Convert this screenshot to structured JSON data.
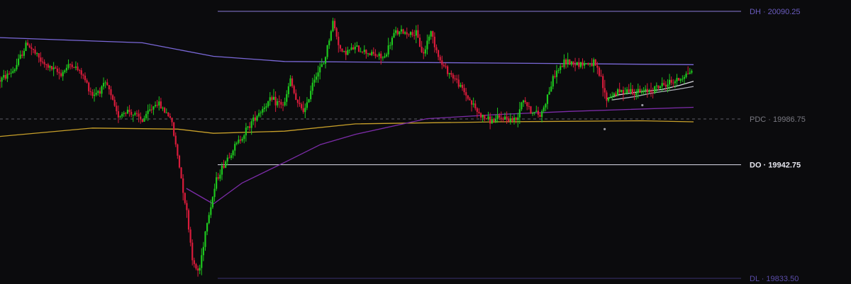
{
  "chart_data": {
    "type": "candlestick",
    "y_range": [
      19830,
      20095
    ],
    "x_range": [
      0,
      1000
    ],
    "grid": false,
    "candle_colors": {
      "up": "#1ec81e",
      "down": "#d91b3b"
    },
    "candle_path": [
      [
        0,
        20024
      ],
      [
        20,
        20034
      ],
      [
        38,
        20060
      ],
      [
        60,
        20040
      ],
      [
        85,
        20030
      ],
      [
        100,
        20040
      ],
      [
        115,
        20030
      ],
      [
        130,
        20010
      ],
      [
        150,
        20020
      ],
      [
        165,
        19990
      ],
      [
        180,
        19995
      ],
      [
        200,
        19985
      ],
      [
        220,
        20003
      ],
      [
        240,
        19988
      ],
      [
        250,
        19950
      ],
      [
        262,
        19900
      ],
      [
        272,
        19845
      ],
      [
        280,
        19840
      ],
      [
        290,
        19885
      ],
      [
        305,
        19930
      ],
      [
        320,
        19950
      ],
      [
        340,
        19970
      ],
      [
        360,
        19990
      ],
      [
        380,
        20005
      ],
      [
        400,
        20000
      ],
      [
        408,
        20025
      ],
      [
        418,
        20000
      ],
      [
        430,
        19995
      ],
      [
        440,
        20025
      ],
      [
        455,
        20040
      ],
      [
        468,
        20080
      ],
      [
        480,
        20050
      ],
      [
        500,
        20055
      ],
      [
        520,
        20050
      ],
      [
        540,
        20045
      ],
      [
        555,
        20070
      ],
      [
        570,
        20070
      ],
      [
        585,
        20068
      ],
      [
        595,
        20048
      ],
      [
        605,
        20072
      ],
      [
        620,
        20040
      ],
      [
        640,
        20025
      ],
      [
        660,
        20005
      ],
      [
        675,
        19990
      ],
      [
        690,
        19985
      ],
      [
        710,
        19988
      ],
      [
        725,
        19985
      ],
      [
        735,
        20008
      ],
      [
        745,
        19995
      ],
      [
        760,
        19990
      ],
      [
        770,
        20010
      ],
      [
        780,
        20030
      ],
      [
        795,
        20042
      ],
      [
        815,
        20040
      ],
      [
        835,
        20040
      ],
      [
        845,
        20025
      ],
      [
        852,
        20005
      ],
      [
        860,
        20010
      ],
      [
        880,
        20015
      ],
      [
        900,
        20012
      ],
      [
        915,
        20015
      ],
      [
        935,
        20020
      ],
      [
        955,
        20025
      ],
      [
        965,
        20030
      ],
      [
        975,
        20035
      ]
    ],
    "moving_averages": [
      {
        "color": "#7a68d8",
        "points": [
          [
            0,
            20065
          ],
          [
            200,
            20060
          ],
          [
            300,
            20047
          ],
          [
            400,
            20042
          ],
          [
            600,
            20041
          ],
          [
            800,
            20040
          ],
          [
            975,
            20039
          ]
        ]
      },
      {
        "color": "#c8a02a",
        "points": [
          [
            0,
            19970
          ],
          [
            130,
            19978
          ],
          [
            250,
            19977
          ],
          [
            300,
            19973
          ],
          [
            400,
            19975
          ],
          [
            500,
            19982
          ],
          [
            700,
            19984
          ],
          [
            900,
            19985
          ],
          [
            975,
            19984
          ]
        ]
      },
      {
        "color": "#7c2ca8",
        "points": [
          [
            262,
            19920
          ],
          [
            300,
            19905
          ],
          [
            340,
            19925
          ],
          [
            400,
            19945
          ],
          [
            450,
            19962
          ],
          [
            500,
            19972
          ],
          [
            600,
            19987
          ],
          [
            700,
            19991
          ],
          [
            800,
            19994
          ],
          [
            975,
            19998
          ]
        ]
      },
      {
        "color": "#d9d9df",
        "points": [
          [
            852,
            20006
          ],
          [
            870,
            20010
          ],
          [
            900,
            20013
          ],
          [
            930,
            20015
          ],
          [
            955,
            20019
          ],
          [
            975,
            20023
          ]
        ]
      },
      {
        "color": "#b0b0ba",
        "points": [
          [
            860,
            20005
          ],
          [
            890,
            20008
          ],
          [
            920,
            20012
          ],
          [
            950,
            20015
          ],
          [
            975,
            20018
          ]
        ]
      }
    ],
    "dots": [
      [
        850,
        19977
      ],
      [
        903,
        20000
      ]
    ],
    "levels": [
      {
        "key": "DH",
        "label": "DH · 20090.25",
        "value": 20090.25,
        "color": "#8a7ad8",
        "style": "solid",
        "x_start": 305,
        "label_color": "#6b5cc0"
      },
      {
        "key": "PDC",
        "label": "PDC · 19986.75",
        "value": 19986.75,
        "color": "#5e5e66",
        "style": "dashed",
        "x_start": 0,
        "label_color": "#7a7a82"
      },
      {
        "key": "DO",
        "label": "DO · 19942.75",
        "value": 19942.75,
        "color": "#c8c8d4",
        "style": "solid",
        "x_start": 305,
        "label_color": "#e6e6ee"
      },
      {
        "key": "DL",
        "label": "DL · 19833.50",
        "value": 19833.5,
        "color": "#3a3070",
        "style": "solid",
        "x_start": 305,
        "label_color": "#5a4ca8"
      }
    ]
  }
}
